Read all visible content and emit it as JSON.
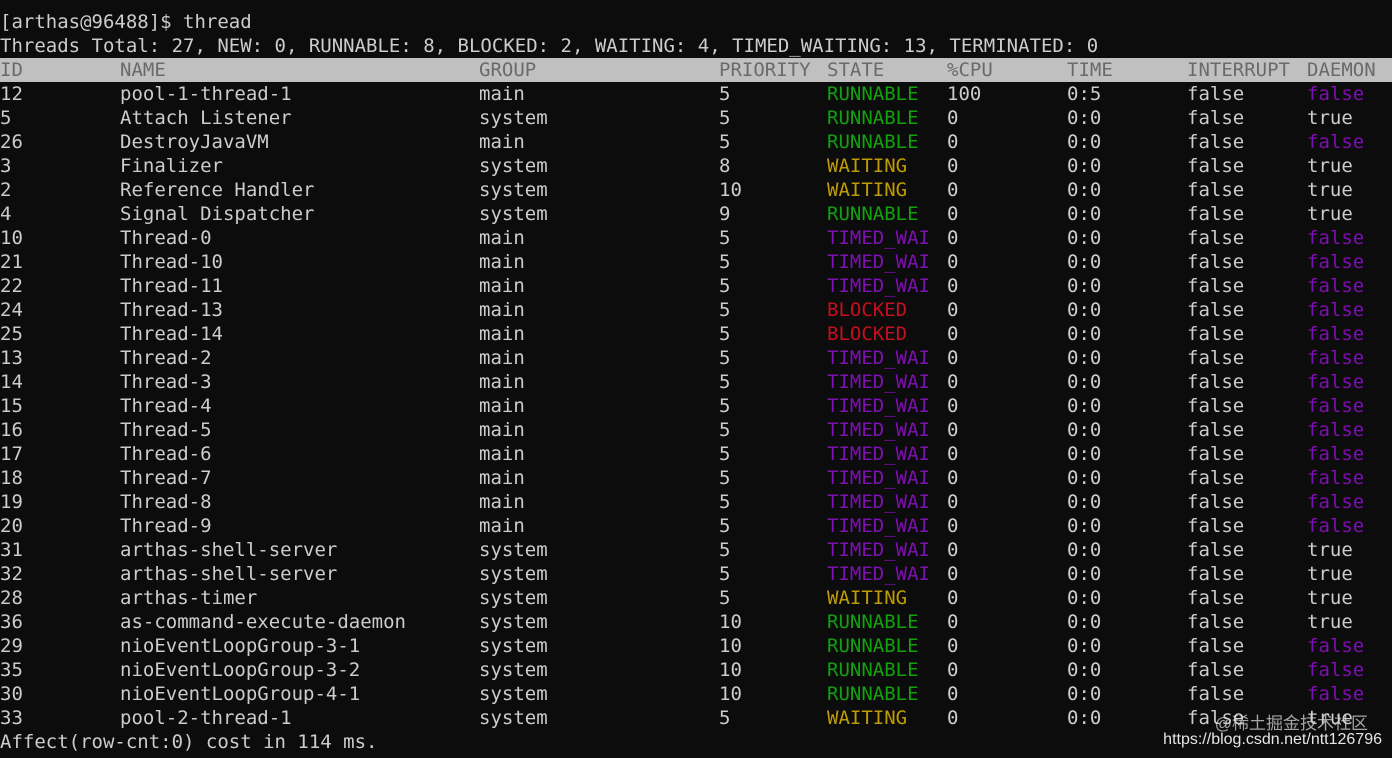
{
  "colors": {
    "background": "#0c0c0c",
    "text": "#cccccc",
    "header_bg": "#c0c0c0",
    "header_text": "#6a6a6a",
    "RUNNABLE": "#13a10e",
    "WAITING": "#c19c00",
    "TIMED_WAI": "#7e0fb2",
    "BLOCKED": "#c50f1f",
    "daemon_false": "#7e0fb2",
    "daemon_true": "#cccccc"
  },
  "prompt_line": "[arthas@96488]$ thread",
  "summary_line": "Threads Total: 27, NEW: 0, RUNNABLE: 8, BLOCKED: 2, WAITING: 4, TIMED_WAITING: 13, TERMINATED: 0",
  "columns": {
    "id": "ID",
    "name": "NAME",
    "group": "GROUP",
    "priority": "PRIORITY",
    "state": "STATE",
    "cpu": "%CPU",
    "time": "TIME",
    "interrupt": "INTERRUPT",
    "daemon": "DAEMON"
  },
  "rows": [
    {
      "id": "12",
      "name": "pool-1-thread-1",
      "group": "main",
      "priority": "5",
      "state": "RUNNABLE",
      "cpu": "100",
      "time": "0:5",
      "interrupt": "false",
      "daemon": "false"
    },
    {
      "id": "5",
      "name": "Attach Listener",
      "group": "system",
      "priority": "5",
      "state": "RUNNABLE",
      "cpu": "0",
      "time": "0:0",
      "interrupt": "false",
      "daemon": "true"
    },
    {
      "id": "26",
      "name": "DestroyJavaVM",
      "group": "main",
      "priority": "5",
      "state": "RUNNABLE",
      "cpu": "0",
      "time": "0:0",
      "interrupt": "false",
      "daemon": "false"
    },
    {
      "id": "3",
      "name": "Finalizer",
      "group": "system",
      "priority": "8",
      "state": "WAITING",
      "cpu": "0",
      "time": "0:0",
      "interrupt": "false",
      "daemon": "true"
    },
    {
      "id": "2",
      "name": "Reference Handler",
      "group": "system",
      "priority": "10",
      "state": "WAITING",
      "cpu": "0",
      "time": "0:0",
      "interrupt": "false",
      "daemon": "true"
    },
    {
      "id": "4",
      "name": "Signal Dispatcher",
      "group": "system",
      "priority": "9",
      "state": "RUNNABLE",
      "cpu": "0",
      "time": "0:0",
      "interrupt": "false",
      "daemon": "true"
    },
    {
      "id": "10",
      "name": "Thread-0",
      "group": "main",
      "priority": "5",
      "state": "TIMED_WAI",
      "cpu": "0",
      "time": "0:0",
      "interrupt": "false",
      "daemon": "false"
    },
    {
      "id": "21",
      "name": "Thread-10",
      "group": "main",
      "priority": "5",
      "state": "TIMED_WAI",
      "cpu": "0",
      "time": "0:0",
      "interrupt": "false",
      "daemon": "false"
    },
    {
      "id": "22",
      "name": "Thread-11",
      "group": "main",
      "priority": "5",
      "state": "TIMED_WAI",
      "cpu": "0",
      "time": "0:0",
      "interrupt": "false",
      "daemon": "false"
    },
    {
      "id": "24",
      "name": "Thread-13",
      "group": "main",
      "priority": "5",
      "state": "BLOCKED",
      "cpu": "0",
      "time": "0:0",
      "interrupt": "false",
      "daemon": "false"
    },
    {
      "id": "25",
      "name": "Thread-14",
      "group": "main",
      "priority": "5",
      "state": "BLOCKED",
      "cpu": "0",
      "time": "0:0",
      "interrupt": "false",
      "daemon": "false"
    },
    {
      "id": "13",
      "name": "Thread-2",
      "group": "main",
      "priority": "5",
      "state": "TIMED_WAI",
      "cpu": "0",
      "time": "0:0",
      "interrupt": "false",
      "daemon": "false"
    },
    {
      "id": "14",
      "name": "Thread-3",
      "group": "main",
      "priority": "5",
      "state": "TIMED_WAI",
      "cpu": "0",
      "time": "0:0",
      "interrupt": "false",
      "daemon": "false"
    },
    {
      "id": "15",
      "name": "Thread-4",
      "group": "main",
      "priority": "5",
      "state": "TIMED_WAI",
      "cpu": "0",
      "time": "0:0",
      "interrupt": "false",
      "daemon": "false"
    },
    {
      "id": "16",
      "name": "Thread-5",
      "group": "main",
      "priority": "5",
      "state": "TIMED_WAI",
      "cpu": "0",
      "time": "0:0",
      "interrupt": "false",
      "daemon": "false"
    },
    {
      "id": "17",
      "name": "Thread-6",
      "group": "main",
      "priority": "5",
      "state": "TIMED_WAI",
      "cpu": "0",
      "time": "0:0",
      "interrupt": "false",
      "daemon": "false"
    },
    {
      "id": "18",
      "name": "Thread-7",
      "group": "main",
      "priority": "5",
      "state": "TIMED_WAI",
      "cpu": "0",
      "time": "0:0",
      "interrupt": "false",
      "daemon": "false"
    },
    {
      "id": "19",
      "name": "Thread-8",
      "group": "main",
      "priority": "5",
      "state": "TIMED_WAI",
      "cpu": "0",
      "time": "0:0",
      "interrupt": "false",
      "daemon": "false"
    },
    {
      "id": "20",
      "name": "Thread-9",
      "group": "main",
      "priority": "5",
      "state": "TIMED_WAI",
      "cpu": "0",
      "time": "0:0",
      "interrupt": "false",
      "daemon": "false"
    },
    {
      "id": "31",
      "name": "arthas-shell-server",
      "group": "system",
      "priority": "5",
      "state": "TIMED_WAI",
      "cpu": "0",
      "time": "0:0",
      "interrupt": "false",
      "daemon": "true"
    },
    {
      "id": "32",
      "name": "arthas-shell-server",
      "group": "system",
      "priority": "5",
      "state": "TIMED_WAI",
      "cpu": "0",
      "time": "0:0",
      "interrupt": "false",
      "daemon": "true"
    },
    {
      "id": "28",
      "name": "arthas-timer",
      "group": "system",
      "priority": "5",
      "state": "WAITING",
      "cpu": "0",
      "time": "0:0",
      "interrupt": "false",
      "daemon": "true"
    },
    {
      "id": "36",
      "name": "as-command-execute-daemon",
      "group": "system",
      "priority": "10",
      "state": "RUNNABLE",
      "cpu": "0",
      "time": "0:0",
      "interrupt": "false",
      "daemon": "true"
    },
    {
      "id": "29",
      "name": "nioEventLoopGroup-3-1",
      "group": "system",
      "priority": "10",
      "state": "RUNNABLE",
      "cpu": "0",
      "time": "0:0",
      "interrupt": "false",
      "daemon": "false"
    },
    {
      "id": "35",
      "name": "nioEventLoopGroup-3-2",
      "group": "system",
      "priority": "10",
      "state": "RUNNABLE",
      "cpu": "0",
      "time": "0:0",
      "interrupt": "false",
      "daemon": "false"
    },
    {
      "id": "30",
      "name": "nioEventLoopGroup-4-1",
      "group": "system",
      "priority": "10",
      "state": "RUNNABLE",
      "cpu": "0",
      "time": "0:0",
      "interrupt": "false",
      "daemon": "false"
    },
    {
      "id": "33",
      "name": "pool-2-thread-1",
      "group": "system",
      "priority": "5",
      "state": "WAITING",
      "cpu": "0",
      "time": "0:0",
      "interrupt": "false",
      "daemon": "true"
    }
  ],
  "footer_line": "Affect(row-cnt:0) cost in 114 ms.",
  "watermark": {
    "site": "@稀土掘金技术社区",
    "url": "https://blog.csdn.net/ntt126796"
  }
}
